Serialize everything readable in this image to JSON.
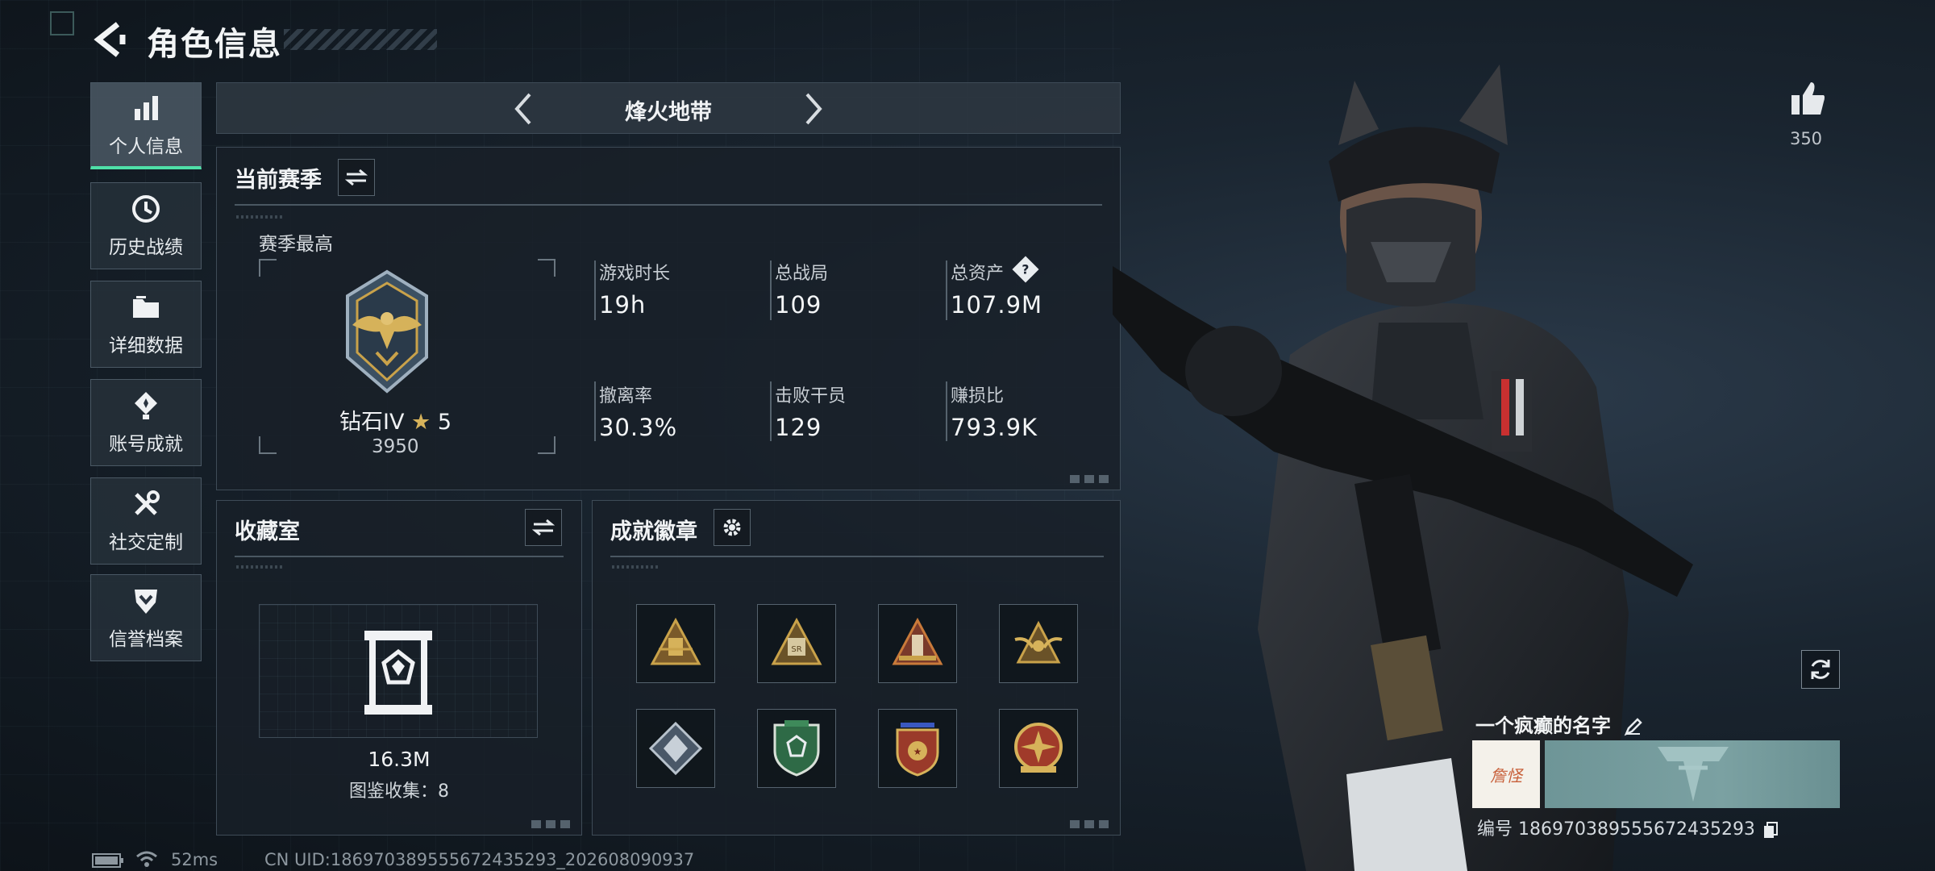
{
  "header": {
    "title": "角色信息"
  },
  "nav": {
    "items": [
      {
        "label": "个人信息",
        "icon": "bar-chart-icon",
        "active": true
      },
      {
        "label": "历史战绩",
        "icon": "history-icon",
        "active": false
      },
      {
        "label": "详细数据",
        "icon": "folder-icon",
        "active": false
      },
      {
        "label": "账号成就",
        "icon": "achievement-icon",
        "active": false
      },
      {
        "label": "社交定制",
        "icon": "tools-icon",
        "active": false
      },
      {
        "label": "信誉档案",
        "icon": "shield-chevron-icon",
        "active": false
      }
    ]
  },
  "map": {
    "title": "烽火地带"
  },
  "season": {
    "heading": "当前赛季",
    "best_label": "赛季最高",
    "rank": "钻石IV",
    "stars": "5",
    "score": "3950",
    "stats": [
      {
        "label": "游戏时长",
        "value": "19h"
      },
      {
        "label": "总战局",
        "value": "109"
      },
      {
        "label": "总资产",
        "value": "107.9M",
        "help": "?"
      },
      {
        "label": "撤离率",
        "value": "30.3%"
      },
      {
        "label": "击败干员",
        "value": "129"
      },
      {
        "label": "赚损比",
        "value": "793.9K"
      }
    ]
  },
  "collection": {
    "heading": "收藏室",
    "value": "16.3M",
    "catalog": "图鉴收集：8"
  },
  "badges": {
    "heading": "成就徽章",
    "items": [
      {
        "icon": "bronze-triangle-badge-icon",
        "color": "#c9a24a"
      },
      {
        "icon": "sr-triangle-badge-icon",
        "color": "#c9a24a"
      },
      {
        "icon": "red-triangle-badge-icon",
        "color": "#c97a3a"
      },
      {
        "icon": "winged-triangle-badge-icon",
        "color": "#c9a24a"
      },
      {
        "icon": "silver-diamond-badge-icon",
        "color": "#b8c2cc"
      },
      {
        "icon": "green-shield-badge-icon",
        "color": "#3e8a5a"
      },
      {
        "icon": "star-shield-badge-icon",
        "color": "#c0503a"
      },
      {
        "icon": "red-round-badge-icon",
        "color": "#b04030"
      }
    ]
  },
  "profile": {
    "likes": "350",
    "name": "一个疯癫的名字",
    "signature": "詹怪",
    "id_line": "编号 186970389555672435293"
  },
  "footer": {
    "ping": "52ms",
    "uid": "CN UID:186970389555672435293_202608090937"
  },
  "colors": {
    "accent": "#4fe0a8",
    "gold": "#c9a24a"
  }
}
